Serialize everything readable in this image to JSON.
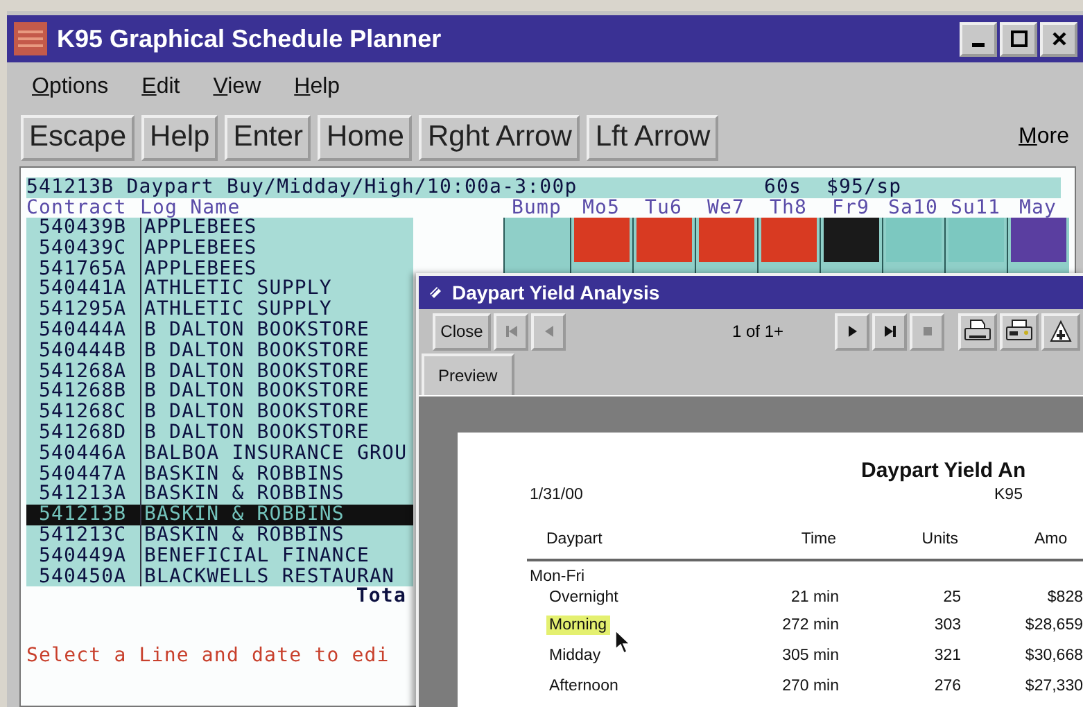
{
  "main_window": {
    "title": "K95 Graphical Schedule Planner",
    "menu": [
      "Options",
      "Edit",
      "View",
      "Help"
    ],
    "toolbar": [
      "Escape",
      "Help",
      "Enter",
      "Home",
      "Rght Arrow",
      "Lft Arrow"
    ],
    "more": "More"
  },
  "terminal": {
    "header": {
      "title": "541213B Daypart Buy/Midday/High/10:00a-3:00p",
      "spot_length": "60s",
      "rate": "$95/sp"
    },
    "columns": {
      "contract": "Contract",
      "log_name": "Log Name",
      "bump": "Bump"
    },
    "days": [
      {
        "label": "Mo5",
        "color": "#d83a22"
      },
      {
        "label": "Tu6",
        "color": "#d83a22"
      },
      {
        "label": "We7",
        "color": "#d83a22"
      },
      {
        "label": "Th8",
        "color": "#d83a22"
      },
      {
        "label": "Fr9",
        "color": "#1a1a1a"
      },
      {
        "label": "Sa10",
        "color": "#7cc8c0"
      },
      {
        "label": "Su11",
        "color": "#7cc8c0"
      },
      {
        "label": "May",
        "color": "#5a3ea0"
      }
    ],
    "rows": [
      {
        "contract": "540439B",
        "name": "APPLEBEES",
        "selected": false
      },
      {
        "contract": "540439C",
        "name": "APPLEBEES",
        "selected": false
      },
      {
        "contract": "541765A",
        "name": "APPLEBEES",
        "selected": false
      },
      {
        "contract": "540441A",
        "name": "ATHLETIC SUPPLY",
        "selected": false
      },
      {
        "contract": "541295A",
        "name": "ATHLETIC SUPPLY",
        "selected": false
      },
      {
        "contract": "540444A",
        "name": "B DALTON BOOKSTORE",
        "selected": false
      },
      {
        "contract": "540444B",
        "name": "B DALTON BOOKSTORE",
        "selected": false
      },
      {
        "contract": "541268A",
        "name": "B DALTON BOOKSTORE",
        "selected": false
      },
      {
        "contract": "541268B",
        "name": "B DALTON BOOKSTORE",
        "selected": false
      },
      {
        "contract": "541268C",
        "name": "B DALTON BOOKSTORE",
        "selected": false
      },
      {
        "contract": "541268D",
        "name": "B DALTON BOOKSTORE",
        "selected": false
      },
      {
        "contract": "540446A",
        "name": "BALBOA INSURANCE GROU",
        "selected": false
      },
      {
        "contract": "540447A",
        "name": "BASKIN & ROBBINS",
        "selected": false
      },
      {
        "contract": "541213A",
        "name": "BASKIN & ROBBINS",
        "selected": false
      },
      {
        "contract": "541213B",
        "name": "BASKIN & ROBBINS",
        "selected": true
      },
      {
        "contract": "541213C",
        "name": "BASKIN & ROBBINS",
        "selected": false
      },
      {
        "contract": "540449A",
        "name": "BENEFICIAL FINANCE",
        "selected": false
      },
      {
        "contract": "540450A",
        "name": "BLACKWELLS RESTAURAN",
        "selected": false
      }
    ],
    "total_label": "Tota",
    "message": "Select a Line and date to edi"
  },
  "dialog": {
    "title": "Daypart Yield Analysis",
    "close": "Close",
    "page_status": "1 of 1+",
    "nav_buttons": [
      {
        "kind": "first",
        "disabled": true
      },
      {
        "kind": "prev",
        "disabled": true
      }
    ],
    "nav_buttons_right": [
      {
        "kind": "next",
        "disabled": false
      },
      {
        "kind": "last",
        "disabled": false
      },
      {
        "kind": "stop",
        "disabled": true
      }
    ],
    "output_buttons": [
      {
        "kind": "print"
      },
      {
        "kind": "print_setup"
      },
      {
        "kind": "export"
      }
    ],
    "tabs": [
      {
        "label": "Preview",
        "selected": true
      }
    ],
    "report": {
      "title": "Daypart Yield An",
      "date": "1/31/00",
      "station": "K95",
      "columns": [
        "Daypart",
        "Time",
        "Units",
        "Amo"
      ],
      "groups": [
        {
          "label": "Mon-Fri",
          "rows": [
            {
              "daypart": "Overnight",
              "time": "21 min",
              "units": "25",
              "amount": "$828",
              "highlighted": false
            },
            {
              "daypart": "Morning",
              "time": "272 min",
              "units": "303",
              "amount": "$28,659",
              "highlighted": true
            },
            {
              "daypart": "Midday",
              "time": "305 min",
              "units": "321",
              "amount": "$30,668",
              "highlighted": false
            },
            {
              "daypart": "Afternoon",
              "time": "270 min",
              "units": "276",
              "amount": "$27,330",
              "highlighted": false
            }
          ]
        }
      ]
    }
  }
}
